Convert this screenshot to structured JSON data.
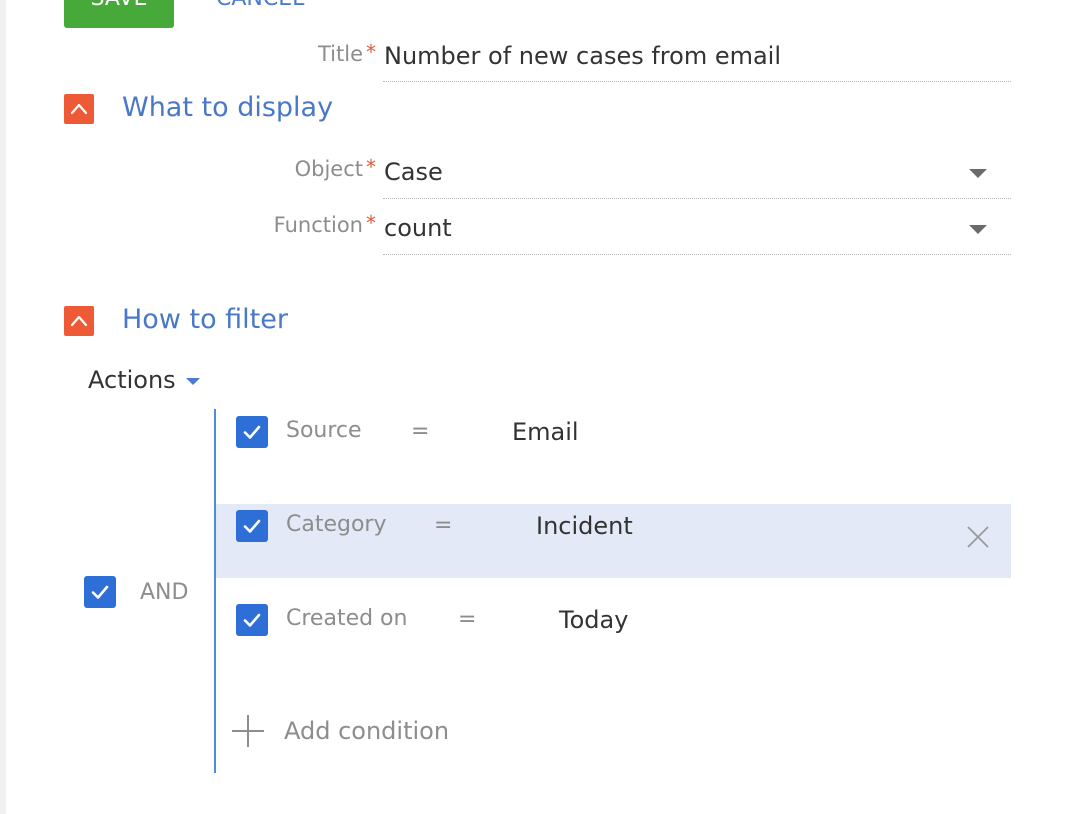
{
  "toolbar": {
    "save_label": "SAVE",
    "cancel_label": "CANCEL"
  },
  "title_field": {
    "label": "Title",
    "required_mark": "*",
    "value": "Number of new cases from email"
  },
  "what_to_display": {
    "title": "What to display",
    "object_field": {
      "label": "Object",
      "required_mark": "*",
      "value": "Case"
    },
    "function_field": {
      "label": "Function",
      "required_mark": "*",
      "value": "count"
    }
  },
  "how_to_filter": {
    "title": "How to filter",
    "actions_label": "Actions",
    "group": {
      "operator": "AND",
      "checked": true
    },
    "conditions": [
      {
        "column": "Source",
        "operator": "=",
        "value": "Email",
        "checked": true,
        "selected": false
      },
      {
        "column": "Category",
        "operator": "=",
        "value": "Incident",
        "checked": true,
        "selected": true
      },
      {
        "column": "Created on",
        "operator": "=",
        "value": "Today",
        "checked": true,
        "selected": false
      }
    ],
    "add_condition_label": "Add condition"
  },
  "colors": {
    "save_green": "#47a93a",
    "link_blue": "#4b7bd0",
    "collapse_orange": "#ee5a35",
    "checkbox_blue": "#2d6fd6",
    "selected_row": "#e3e9f7",
    "required_red": "#e35a3f"
  },
  "icons": {
    "collapse": "chevron-up-icon",
    "checkbox": "checkmark-icon",
    "dropdown": "caret-down-icon",
    "remove": "close-icon",
    "add": "plus-icon"
  }
}
